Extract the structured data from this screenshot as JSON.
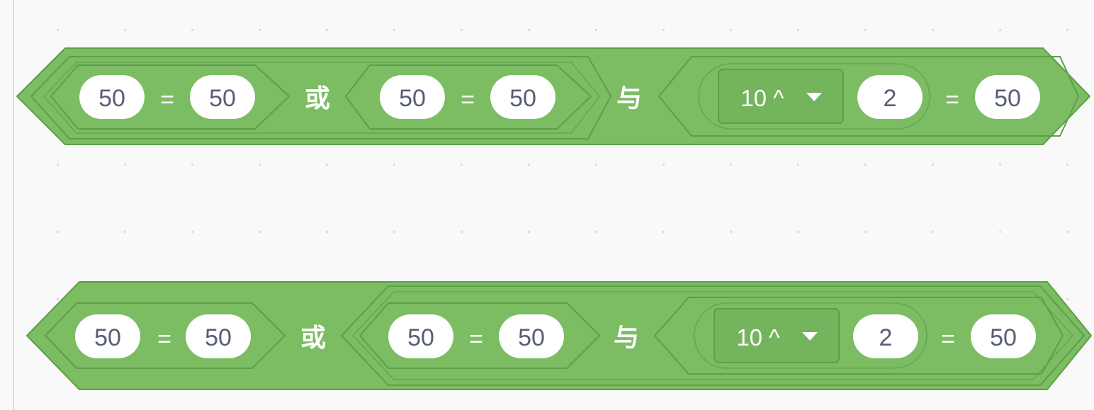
{
  "workspace": {
    "blocks": [
      {
        "id": "block-1",
        "left_cond": {
          "a": "50",
          "op": "=",
          "b": "50"
        },
        "or_label": "或",
        "mid_cond": {
          "a": "50",
          "op": "=",
          "b": "50"
        },
        "and_label": "与",
        "right_cond": {
          "menu": "10 ^",
          "arg": "2",
          "op": "=",
          "b": "50"
        }
      },
      {
        "id": "block-2",
        "left_cond": {
          "a": "50",
          "op": "=",
          "b": "50"
        },
        "or_label": "或",
        "mid_cond": {
          "a": "50",
          "op": "=",
          "b": "50"
        },
        "and_label": "与",
        "right_cond": {
          "menu": "10 ^",
          "arg": "2",
          "op": "=",
          "b": "50"
        }
      }
    ]
  },
  "colors": {
    "operator_green": "#7cbc63",
    "operator_edge": "#5c9f4a",
    "slot_text": "#575e75",
    "background": "#f9f9f9"
  },
  "icons": {
    "dropdown": "triangle-down-icon"
  }
}
